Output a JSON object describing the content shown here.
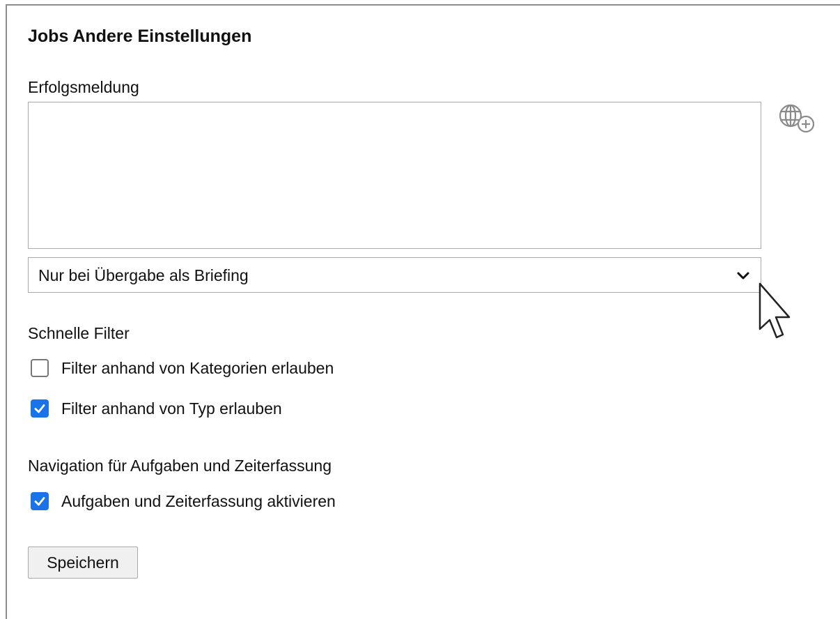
{
  "page": {
    "title": "Jobs Andere Einstellungen"
  },
  "success_message": {
    "label": "Erfolgsmeldung",
    "value": "",
    "translate_icon": "globe-plus-icon"
  },
  "delivery_select": {
    "selected": "Nur bei Übergabe als Briefing",
    "chevron_icon": "chevron-down-icon"
  },
  "quick_filters": {
    "heading": "Schnelle Filter",
    "options": [
      {
        "label": "Filter anhand von Kategorien erlauben",
        "checked": false
      },
      {
        "label": "Filter anhand von Typ erlauben",
        "checked": true
      }
    ]
  },
  "task_navigation": {
    "heading": "Navigation für Aufgaben und Zeiterfassung",
    "options": [
      {
        "label": "Aufgaben und Zeiterfassung aktivieren",
        "checked": true
      }
    ]
  },
  "actions": {
    "save_label": "Speichern"
  },
  "colors": {
    "checkbox_checked": "#1a73e8",
    "border": "#a9a9a9",
    "button_bg": "#f0f0f0"
  }
}
